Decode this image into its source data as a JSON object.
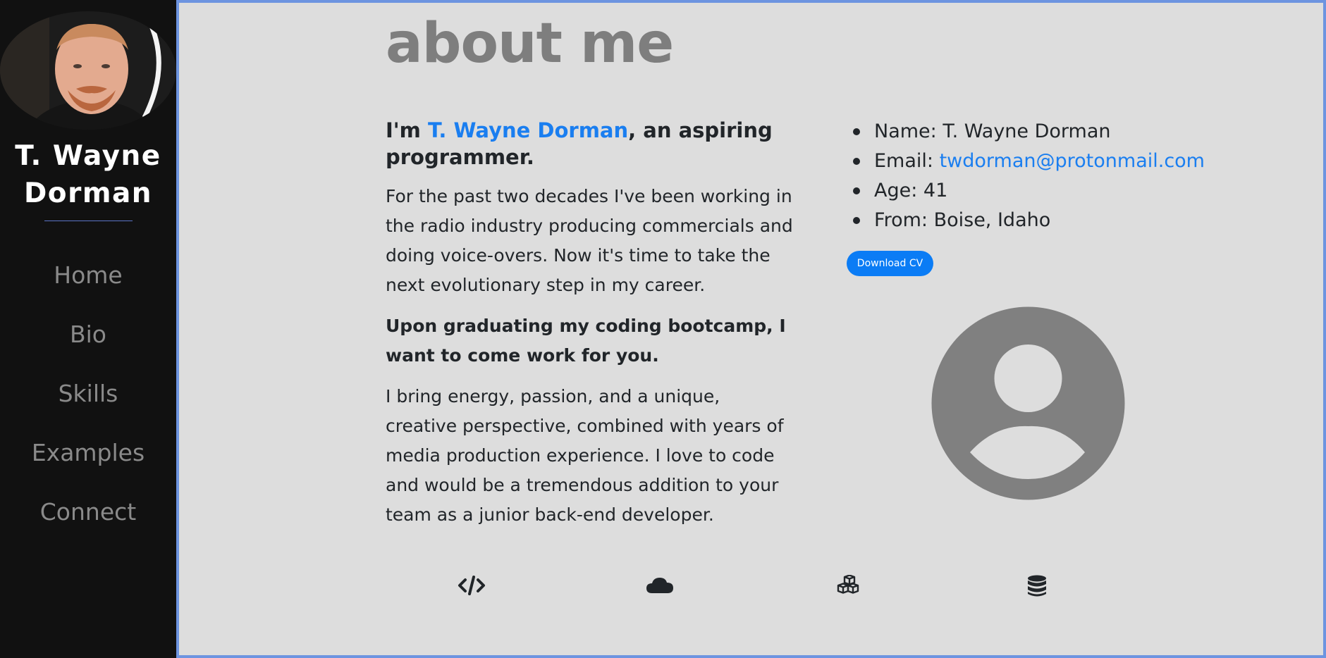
{
  "sidebar": {
    "name_line1": "T. Wayne",
    "name_line2": "Dorman",
    "nav": [
      "Home",
      "Bio",
      "Skills",
      "Examples",
      "Connect"
    ]
  },
  "main": {
    "heading": "about me",
    "intro_prefix": "I'm ",
    "intro_name": "T. Wayne Dorman",
    "intro_suffix": ", an aspiring programmer.",
    "para1": "For the past two decades I've been working in the radio industry producing commercials and doing voice-overs. Now it's time to take the next evolutionary step in my career.",
    "para2": "Upon graduating my coding bootcamp, I want to come work for you.",
    "para3": "I bring energy, passion, and a unique, creative perspective, combined with years of media production experience. I love to code and would be a tremendous addition to your team as a junior back-end developer."
  },
  "info": {
    "name_label": "Name: ",
    "name_value": "T. Wayne Dorman",
    "email_label": "Email: ",
    "email_value": "twdorman@protonmail.com",
    "age_label": "Age: ",
    "age_value": "41",
    "from_label": "From: ",
    "from_value": "Boise, Idaho"
  },
  "cv_button": "Download CV",
  "icons": [
    "code-icon",
    "cloud-icon",
    "cubes-icon",
    "database-icon"
  ],
  "colors": {
    "sidebar_bg": "#111111",
    "main_bg": "#dddddd",
    "frame_border": "#6d94e0",
    "link_blue": "#1a7ef0",
    "button_blue": "#0b7cf5",
    "heading_gray": "#7e7e7e"
  }
}
